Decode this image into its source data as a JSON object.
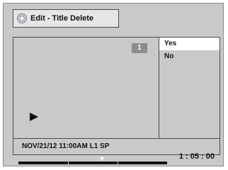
{
  "header": {
    "title": "Edit - Title Delete",
    "icon": "disc-icon"
  },
  "preview": {
    "title_number": "1",
    "status_icon": "play-icon"
  },
  "menu": {
    "items": [
      {
        "label": "Yes",
        "selected": true
      },
      {
        "label": "No",
        "selected": false
      }
    ]
  },
  "info": {
    "recording": "NOV/21/12 11:00AM L1 SP"
  },
  "playback": {
    "time": "1 : 05 : 00"
  },
  "colors": {
    "panel": "#c9c9c9",
    "highlight": "#ffffff",
    "border": "#4a4a4a"
  }
}
